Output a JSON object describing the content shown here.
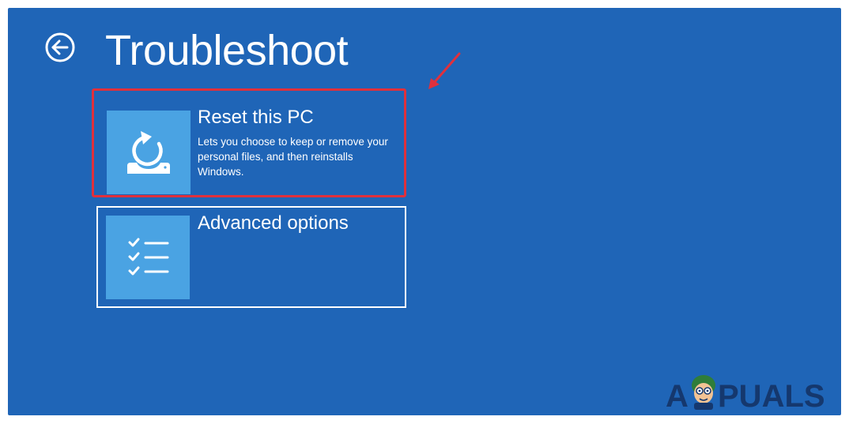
{
  "screen": {
    "title": "Troubleshoot",
    "background_color": "#1f65b7"
  },
  "back": {
    "icon": "back-arrow-icon"
  },
  "options": [
    {
      "heading": "Reset this PC",
      "description": "Lets you choose to keep or remove your personal files, and then reinstalls Windows.",
      "icon": "reset-pc-icon",
      "highlighted": true
    },
    {
      "heading": "Advanced options",
      "description": "",
      "icon": "checklist-icon",
      "selected": true
    }
  ],
  "annotation": {
    "highlight_color": "#e0303c",
    "arrow_icon": "red-arrow-icon"
  },
  "watermark": {
    "text": "APPUALS"
  },
  "colors": {
    "tile_icon_bg": "#4aa3e3",
    "text": "#ffffff"
  }
}
